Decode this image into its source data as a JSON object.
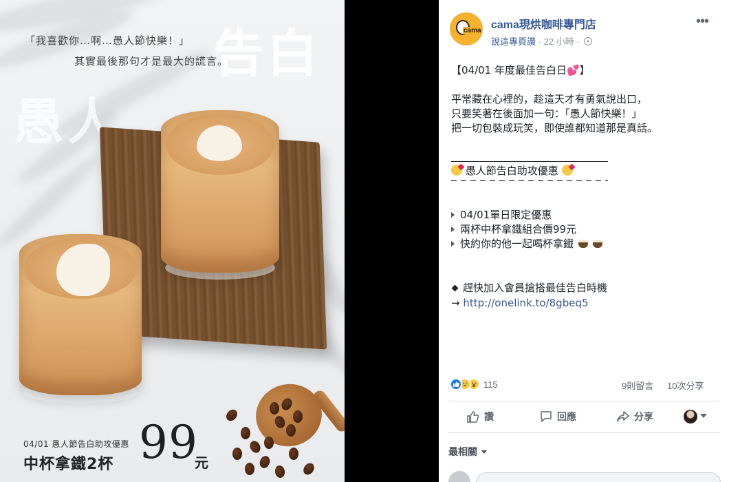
{
  "promo": {
    "quote": "「我喜歡你…啊…愚人節快樂！」",
    "subline": "其實最後那句才是最大的謊言。",
    "big_word_1": "告白",
    "big_word_2": "愚人",
    "small_line": "04/01 愚人節告白助攻優惠",
    "main_line": "中杯拿鐵2杯",
    "price": "99",
    "unit": "元"
  },
  "post": {
    "page_name": "cama現烘咖啡專門店",
    "avatar_text": "cama",
    "meta_link": "說這專頁讚",
    "meta_time": "22 小時",
    "more_label": "•••",
    "title": "【04/01 年度最佳告白日💕】",
    "paragraph": [
      "平常藏在心裡的，趁這天才有勇氣說出口，",
      "只要笑著在後面加一句：「愚人節快樂！」",
      "把一切包裝成玩笑，即使誰都知道那是真話。"
    ],
    "section_title": "愚人節告白助攻優惠",
    "bullets": [
      "04/01單日限定優惠",
      "兩杯中杯拿鐵組合價99元",
      "快約你的他一起喝杯拿鐵"
    ],
    "cta_line": "趕快加入會員搶搭最佳告白時機",
    "link_prefix": "→",
    "link": "http://onelink.to/8gbeq5",
    "reaction_count": "115",
    "comments_count": "9則留言",
    "shares_count": "10次分享",
    "actions": {
      "like": "讚",
      "comment": "回應",
      "share": "分享"
    },
    "sort_label": "最相關"
  },
  "colors": {
    "link": "#365899",
    "muted": "#90949c",
    "like_blue": "#1877f2"
  }
}
